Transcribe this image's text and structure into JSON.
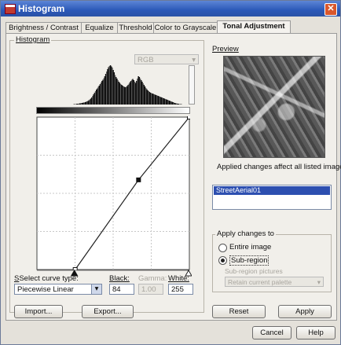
{
  "window": {
    "title": "Histogram",
    "close_glyph": "✕"
  },
  "tabs": [
    {
      "label": "Brightness / Contrast"
    },
    {
      "label": "Equalize"
    },
    {
      "label": "Threshold"
    },
    {
      "label": "Color to Grayscale"
    },
    {
      "label": "Tonal Adjustment",
      "active": true
    }
  ],
  "histogram": {
    "group_label": "Histogram",
    "channel_select": "RGB",
    "bins": [
      0,
      0,
      0,
      0,
      0,
      0,
      0,
      0,
      0,
      0,
      0,
      0,
      0,
      0,
      0,
      0,
      0,
      0,
      0,
      0,
      0,
      0,
      0,
      0,
      0,
      0,
      0,
      0,
      0,
      0,
      0,
      0,
      0,
      0,
      0,
      0,
      0,
      0,
      0,
      0,
      1,
      1,
      1,
      2,
      2,
      2,
      3,
      3,
      4,
      4,
      5,
      5,
      6,
      7,
      8,
      9,
      11,
      13,
      15,
      18,
      22,
      26,
      30,
      34,
      38,
      41,
      45,
      48,
      52,
      56,
      60,
      63,
      67,
      72,
      78,
      84,
      90,
      95,
      98,
      100,
      97,
      94,
      88,
      82,
      75,
      70,
      66,
      62,
      58,
      55,
      52,
      50,
      48,
      46,
      45,
      44,
      45,
      47,
      50,
      53,
      57,
      60,
      63,
      65,
      62,
      58,
      55,
      60,
      66,
      72,
      70,
      66,
      62,
      58,
      54,
      50,
      46,
      42,
      39,
      36,
      34,
      32,
      30,
      29,
      28,
      27,
      26,
      25,
      24,
      23,
      22,
      21,
      20,
      19,
      18,
      17,
      16,
      15,
      14,
      13,
      12,
      11,
      10,
      9,
      8,
      7,
      6,
      5,
      4,
      3,
      3,
      2,
      2,
      1,
      1,
      1,
      0,
      0,
      0,
      0
    ]
  },
  "curve": {
    "points": [
      [
        64,
        0
      ],
      [
        170,
        150
      ],
      [
        255,
        255
      ]
    ],
    "black_pointer": 64,
    "white_pointer": 255
  },
  "controls": {
    "curve_type_label": "Select curve type:",
    "curve_type_value": "Piecewise Linear",
    "black_label": "Black:",
    "black_value": "84",
    "gamma_label": "Gamma:",
    "gamma_value": "1.00",
    "white_label": "White:",
    "white_value": "255",
    "import_label": "Import...",
    "export_label": "Export..."
  },
  "preview": {
    "group_label": "Preview",
    "note": "Applied changes affect all listed images.",
    "list_items": [
      "StreetAerial01"
    ]
  },
  "apply": {
    "group_label": "Apply changes to",
    "options": [
      {
        "label": "Entire image",
        "selected": false
      },
      {
        "label": "Sub-region",
        "selected": true
      }
    ],
    "subregion_label": "Sub-region pictures",
    "subregion_value": "Retain current palette",
    "reset_label": "Reset",
    "apply_label": "Apply"
  },
  "footer": {
    "cancel_label": "Cancel",
    "help_label": "Help"
  }
}
